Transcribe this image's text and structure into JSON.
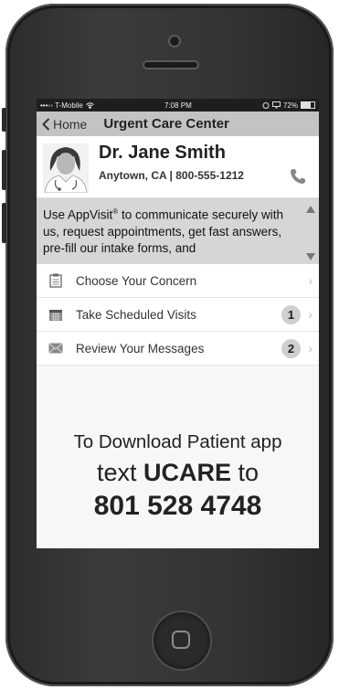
{
  "status_bar": {
    "carrier": "•••◦◦ T-Mobile",
    "time": "7:08 PM",
    "battery": "72%"
  },
  "nav": {
    "back_label": "Home",
    "title": "Urgent Care Center"
  },
  "profile": {
    "name": "Dr. Jane Smith",
    "location_phone": "Anytown, CA | 800-555-1212"
  },
  "banner": {
    "text_before": "Use AppVisit",
    "registered": "®",
    "text_after": " to communicate securely with us, request appointments, get fast answers, pre-fill our intake forms, and"
  },
  "menu": [
    {
      "label": "Choose Your Concern",
      "badge": null,
      "icon": "clipboard-icon"
    },
    {
      "label": "Take Scheduled Visits",
      "badge": "1",
      "icon": "calendar-icon"
    },
    {
      "label": "Review Your Messages",
      "badge": "2",
      "icon": "envelope-icon"
    }
  ],
  "download": {
    "line1": "To Download Patient app",
    "line2_prefix": "text ",
    "keyword": "UCARE",
    "line2_suffix": " to",
    "number": "801 528 4748"
  }
}
